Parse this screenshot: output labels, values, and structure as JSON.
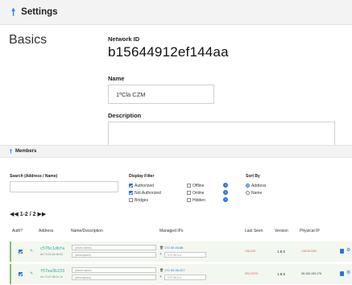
{
  "settings": {
    "title": "Settings",
    "section": "Basics",
    "network_id_label": "Network ID",
    "network_id": "b15644912ef144aa",
    "name_label": "Name",
    "name_value": "1ªCla CZM",
    "description_label": "Description"
  },
  "members": {
    "title": "Members",
    "search_label": "Search (Address / Name)",
    "display_filter_label": "Display Filter",
    "filters": [
      {
        "label": "Authorized",
        "checked": true
      },
      {
        "label": "Not Authorized",
        "checked": true
      },
      {
        "label": "Bridges",
        "checked": false
      },
      {
        "label": "Offline",
        "checked": false
      },
      {
        "label": "Online",
        "checked": false
      },
      {
        "label": "Hidden",
        "checked": false
      }
    ],
    "sort_by_label": "Sort By",
    "sort_options": [
      {
        "label": "Address",
        "selected": true
      },
      {
        "label": "Name",
        "selected": false
      }
    ],
    "pager": "◀◀ 1-2 / 2 ▶▶",
    "columns": [
      "Auth?",
      "Address",
      "Name/Description",
      "Managed IPs",
      "Last Seen",
      "Version",
      "Physical IP"
    ],
    "name_placeholder": "(short-name)",
    "desc_placeholder": "(description)",
    "rows": [
      {
        "address": "c576c1dbfa",
        "address_sub": "de:74:02:4e:db:62",
        "managed_ip": "172.30.46.88",
        "ip_input": "172.30.0.x",
        "last_seen": "ONLINE",
        "version": "1.8.5",
        "physical_ip": "UNKNOWN"
      },
      {
        "address": "f57ea3b233",
        "address_sub": "de:74:d7:98:0c:1e",
        "managed_ip": "172.30.36.227",
        "ip_input": "172.30.0.x",
        "last_seen": "RELAYED",
        "version": "1.8.5",
        "physical_ip": "95.153.153.176"
      }
    ]
  },
  "colors": {
    "accent": "#2f73d8",
    "row_bg": "#f2f8ef",
    "row_border": "#7ec26f",
    "address": "#2aa6a0",
    "warn": "#e0645c"
  }
}
